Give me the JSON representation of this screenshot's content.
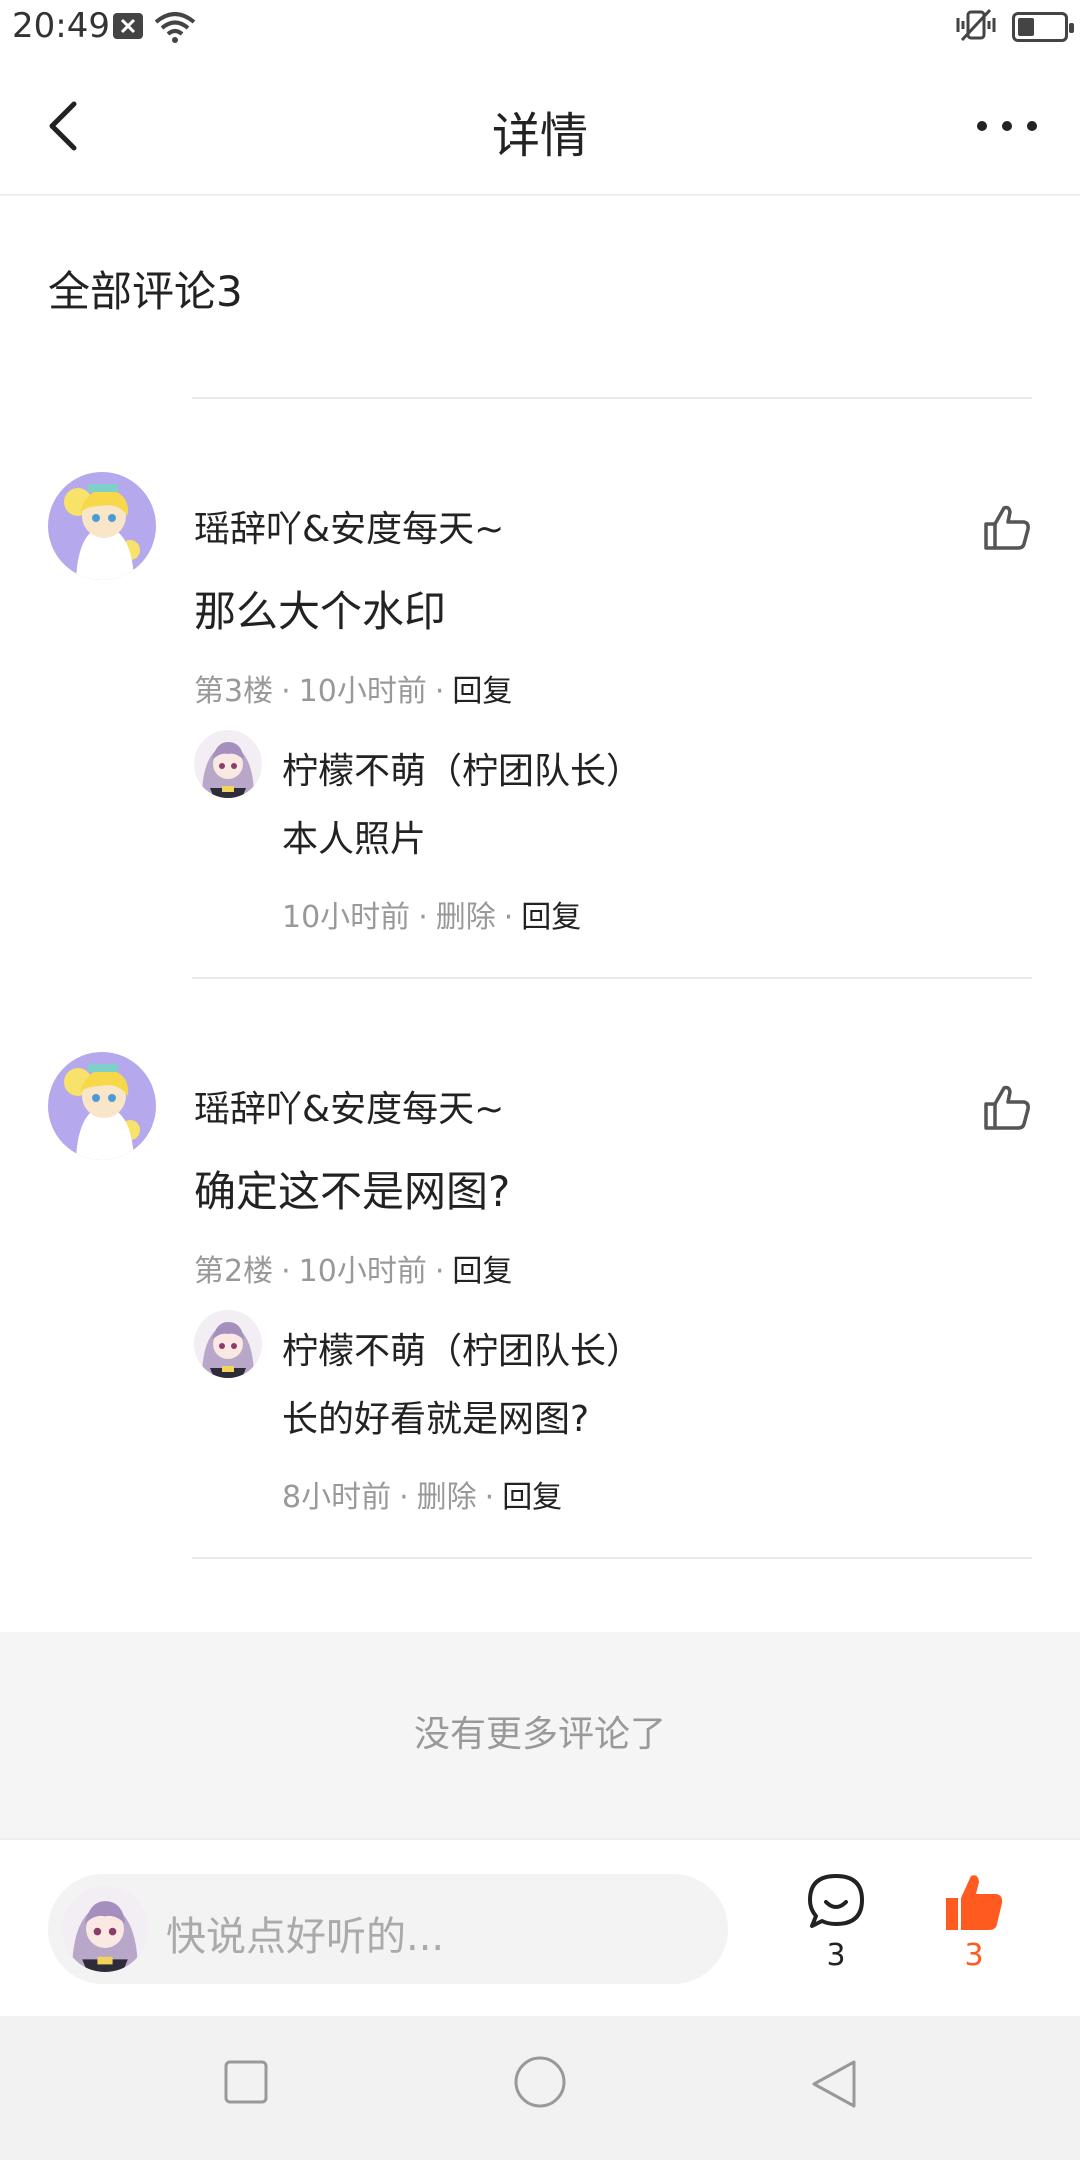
{
  "status_bar": {
    "time": "20:49"
  },
  "nav": {
    "title": "详情"
  },
  "section": {
    "title": "全部评论3"
  },
  "comments": [
    {
      "username": "瑶辞吖&安度每天~",
      "content": "那么大个水印",
      "floor": "第3楼",
      "time": "10小时前",
      "reply_label": "回复",
      "sub_reply": {
        "username": "柠檬不萌（柠团队长）",
        "content": "本人照片",
        "time": "10小时前",
        "delete_label": "删除",
        "reply_label": "回复"
      }
    },
    {
      "username": "瑶辞吖&安度每天~",
      "content": "确定这不是网图?",
      "floor": "第2楼",
      "time": "10小时前",
      "reply_label": "回复",
      "sub_reply": {
        "username": "柠檬不萌（柠团队长）",
        "content": "长的好看就是网图?",
        "time": "8小时前",
        "delete_label": "删除",
        "reply_label": "回复"
      }
    }
  ],
  "no_more": "没有更多评论了",
  "input_bar": {
    "placeholder": "快说点好听的...",
    "comment_count": "3",
    "like_count": "3"
  },
  "colors": {
    "accent": "#ff5a1f",
    "meta": "#999999",
    "text": "#222222"
  }
}
